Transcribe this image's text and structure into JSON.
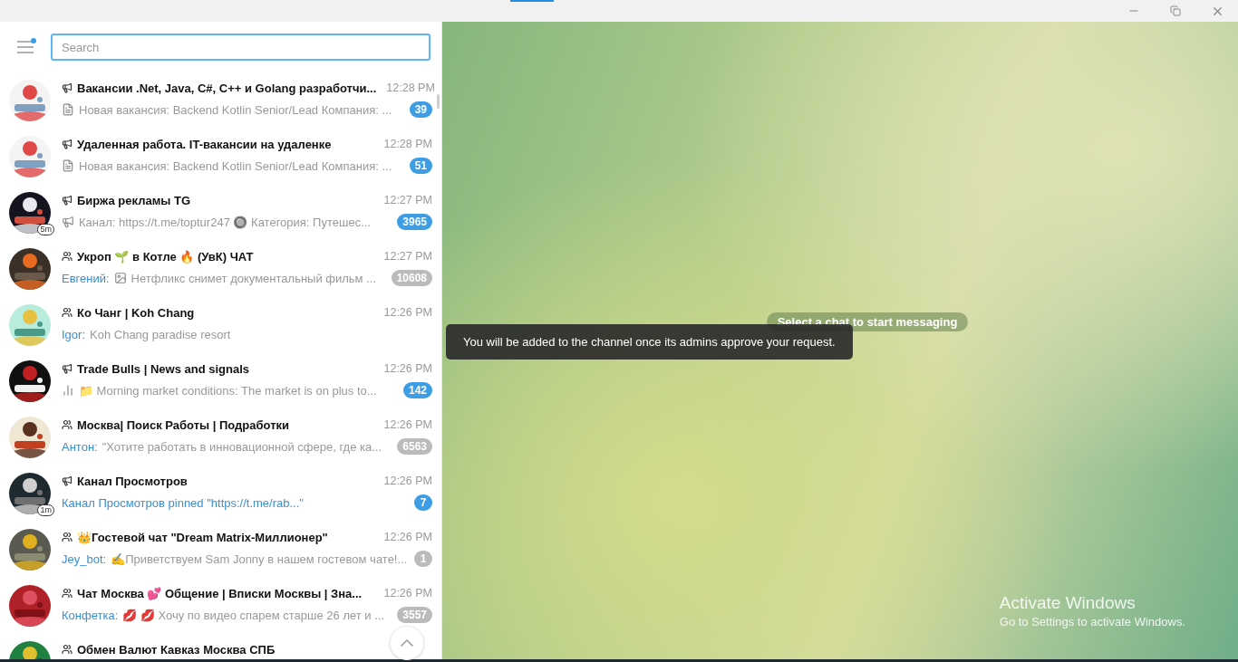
{
  "search": {
    "placeholder": "Search"
  },
  "menu": {
    "has_notification": true
  },
  "chats": [
    {
      "kind": "channel",
      "title": "Вакансии .Net, Java, C#, C++ и Golang разработчи...",
      "time": "12:28 PM",
      "thumbnail": {
        "kind": "document"
      },
      "preview": {
        "kind": "text",
        "text": "Новая вакансия: Backend Kotlin Senior/Lead  Компания: ..."
      },
      "unread": "39",
      "muted": false
    },
    {
      "kind": "channel",
      "title": "Удаленная работа. IT-вакансии на удаленке",
      "time": "12:28 PM",
      "thumbnail": {
        "kind": "document"
      },
      "preview": {
        "kind": "text",
        "text": "Новая вакансия: Backend Kotlin Senior/Lead  Компания: ..."
      },
      "unread": "51",
      "muted": false
    },
    {
      "kind": "channel",
      "title": "Биржа рекламы TG",
      "time": "12:27 PM",
      "avatar_badge": "5m",
      "thumbnail": {
        "kind": "megaphone"
      },
      "preview": {
        "kind": "text",
        "text": "Канал: https://t.me/toptur247 🔘 Категория: Путешес..."
      },
      "unread": "3965",
      "muted": false
    },
    {
      "kind": "group",
      "title": "Укроп 🌱 в Котле 🔥 (УвК) ЧАТ",
      "time": "12:27 PM",
      "sender": "Евгений:",
      "preview": {
        "kind": "text",
        "text": "Нетфликс снимет документальный фильм ..."
      },
      "unread": "10608",
      "muted": true
    },
    {
      "kind": "group",
      "title": "Ко Чанг | Koh Chang",
      "time": "12:26 PM",
      "sender": "Igor:",
      "preview": {
        "kind": "text",
        "text": "Koh Chang paradise resort"
      }
    },
    {
      "kind": "channel",
      "title": "Trade Bulls | News and signals",
      "time": "12:26 PM",
      "thumbnail": {
        "kind": "chart"
      },
      "preview": {
        "kind": "text",
        "text": "📁 Morning market conditions:  The market is on plus to..."
      },
      "unread": "142",
      "muted": false
    },
    {
      "kind": "group",
      "title": "Москва| Поиск Работы | Подработки",
      "time": "12:26 PM",
      "sender": "Антон:",
      "preview": {
        "kind": "text",
        "text": "\"Хотите работать в инновационной сфере, где ка..."
      },
      "unread": "6563",
      "muted": true
    },
    {
      "kind": "channel",
      "title": "Канал Просмотров",
      "time": "12:26 PM",
      "avatar_badge": "1m",
      "preview": {
        "kind": "service",
        "text": "Канал Просмотров pinned \"https://t.me/rab...\""
      },
      "unread": "7",
      "muted": false
    },
    {
      "kind": "group",
      "title": "👑Гостевой чат \"Dream Matrix-Миллионер\"",
      "time": "12:26 PM",
      "sender": "Jey_bot:",
      "preview": {
        "kind": "text",
        "text": "✍Приветствуем Sam Jonny в нашем гостевом чате!..."
      },
      "unread": "1",
      "muted": true
    },
    {
      "kind": "group",
      "title": "Чат Москва 💕 Общение | Вписки Москвы | Зна...",
      "time": "12:26 PM",
      "sender": "Конфетка:",
      "preview": {
        "kind": "text",
        "text": "💋 💋 Хочу по видео  спарем старше 26 лет и ..."
      },
      "unread": "3557",
      "muted": true
    },
    {
      "kind": "group",
      "title": "Обмен Валют Кавказ Москва СПБ"
    }
  ],
  "empty_state": "Select a chat to start messaging",
  "toast": "You will be added to the channel once its admins approve your request.",
  "os_notice": {
    "title": "Activate Windows",
    "text": "Go to Settings to activate Windows."
  }
}
